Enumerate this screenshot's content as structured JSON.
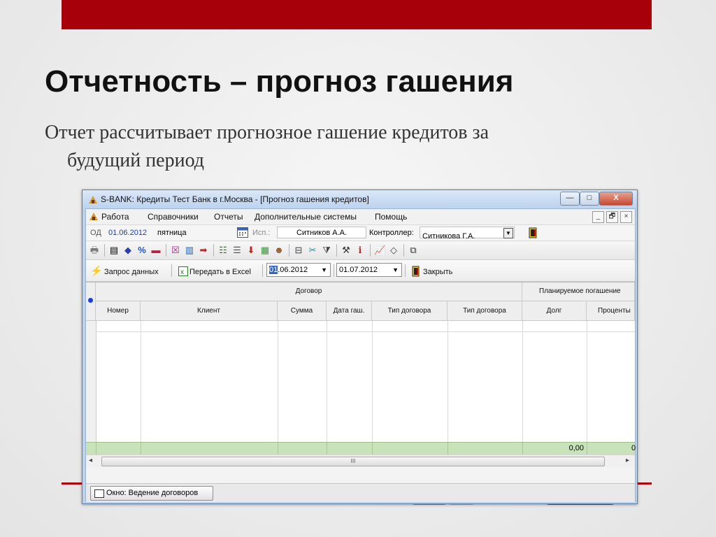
{
  "slide": {
    "title": "Отчетность – прогноз гашения",
    "subtitle_line1": "Отчет рассчитывает прогнозное гашение кредитов за",
    "subtitle_line2": "будущий период"
  },
  "window": {
    "title": "S-BANK: Кредиты Тест Банк в г.Москва - [Прогноз гашения кредитов]",
    "minimize": "—",
    "maximize": "□",
    "close": "X"
  },
  "menu": {
    "items": [
      "Работа",
      "Справочники",
      "Отчеты",
      "Дополнительные системы",
      "Помощь"
    ],
    "mdi_min": "_",
    "mdi_restore": "🗗",
    "mdi_close": "×"
  },
  "info": {
    "od_label": "ОД",
    "od_date": "01.06.2012",
    "weekday": "пятница",
    "isp_label": "Исп.:",
    "isp_value": "Ситников А.А.",
    "controller_label": "Контроллер:",
    "controller_value": "Ситникова Г.А."
  },
  "request_bar": {
    "request_label": "Запрос данных",
    "excel_label": "Передать в Excel",
    "date_from": "01.06.2012",
    "date_from_sel": "01",
    "date_from_rest": ".06.2012",
    "date_to": "01.07.2012",
    "close_label": "Закрыть"
  },
  "grid": {
    "group1": "Договор",
    "group2": "Планируемое погашение",
    "columns": [
      "Номер",
      "Клиент",
      "Сумма",
      "Дата гаш.",
      "Тип договора",
      "Тип договора",
      "Долг",
      "Проценты"
    ],
    "total_debt": "0,00",
    "total_cut": "0"
  },
  "scroll": {
    "left": "◂",
    "right": "▸",
    "grip": "III"
  },
  "taskbar": {
    "item": "Окно: Ведение договоров"
  },
  "colors": {
    "accent": "#a8000a",
    "total_row": "#c8e3b9",
    "window_frame": "#bcd3ee"
  }
}
